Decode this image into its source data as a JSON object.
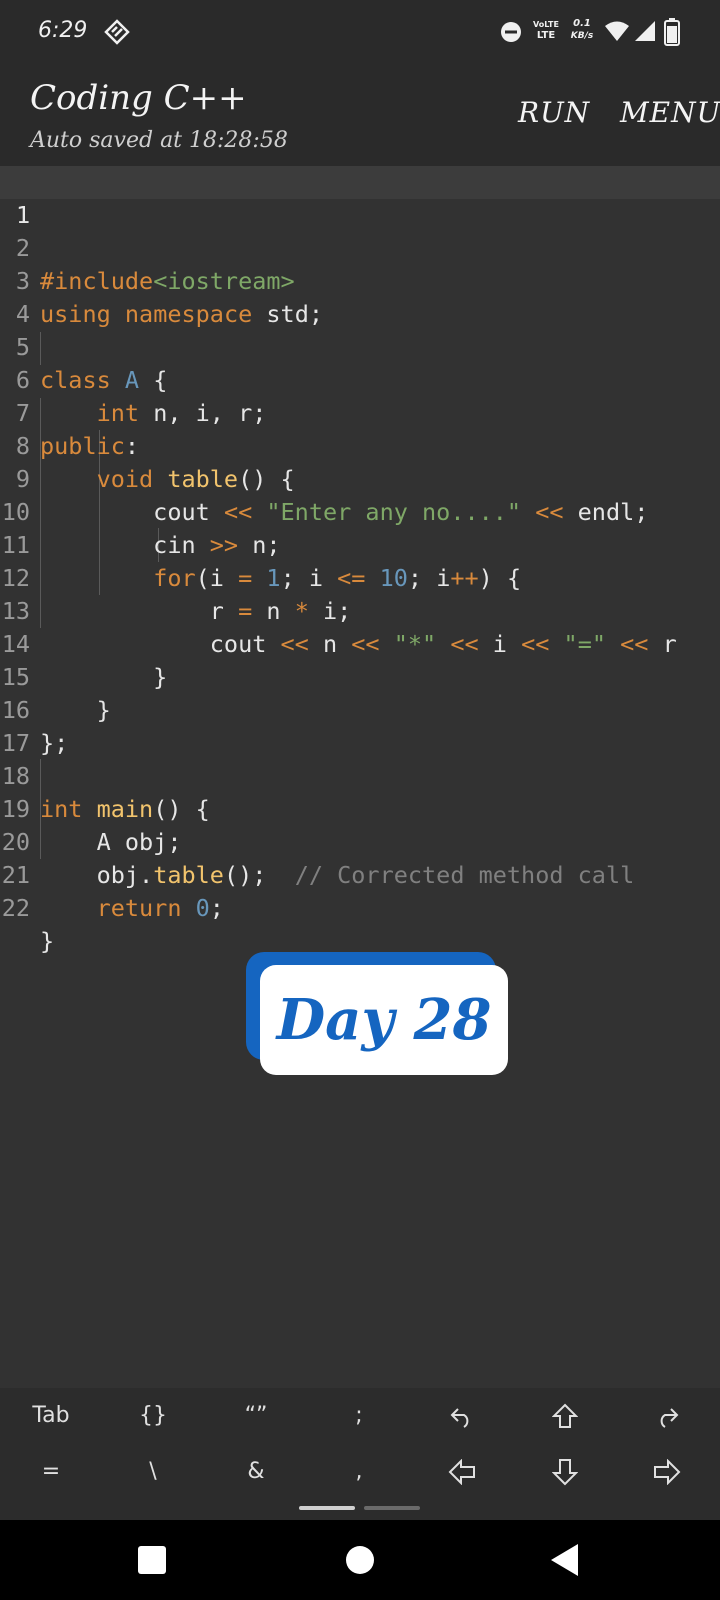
{
  "status_bar": {
    "time": "6:29",
    "icons": [
      "shield-icon",
      "do-not-disturb-icon",
      "volte-icon",
      "data-speed-icon",
      "wifi-icon",
      "signal-icon",
      "battery-icon"
    ],
    "volte_label_top": "VoLTE",
    "volte_label": "LTE",
    "speed_value": "0.1",
    "speed_unit": "KB/s"
  },
  "app_bar": {
    "title": "Coding C++",
    "subtitle": "Auto saved at 18:28:58",
    "run_label": "RUN",
    "menu_label": "MENU"
  },
  "editor": {
    "line_numbers": [
      "1",
      "2",
      "3",
      "4",
      "5",
      "6",
      "7",
      "8",
      "9",
      "10",
      "11",
      "12",
      "13",
      "14",
      "15",
      "16",
      "17",
      "18",
      "19",
      "20",
      "21",
      "22"
    ],
    "lines": [
      "",
      "#include<iostream>",
      "using namespace std;",
      "",
      "class A {",
      "    int n, i, r;",
      "public:",
      "    void table() {",
      "        cout << \"Enter any no....\" << endl;",
      "        cin >> n;",
      "        for(i = 1; i <= 10; i++) {",
      "            r = n * i;",
      "            cout << n << \"*\" << i << \"=\" << r",
      "        }",
      "    }",
      "};",
      "",
      "int main() {",
      "    A obj;",
      "    obj.table();  // Corrected method call",
      "    return 0;",
      "}"
    ]
  },
  "badge": {
    "text": "Day 28"
  },
  "keys": {
    "row1": [
      "Tab",
      "{}",
      "“”",
      ";",
      "undo-icon",
      "shift-up-icon",
      "redo-icon"
    ],
    "row2": [
      "=",
      "\\",
      "&",
      ",",
      "arrow-left-icon",
      "arrow-down-icon",
      "arrow-right-icon"
    ]
  },
  "colors": {
    "background": "#323232",
    "bar": "#2a2a2a",
    "keyword": "#d98a3c",
    "function": "#f2c46d",
    "string": "#7fa867",
    "number": "#6897bb",
    "comment": "#808080",
    "badge_blue": "#1565c0"
  }
}
